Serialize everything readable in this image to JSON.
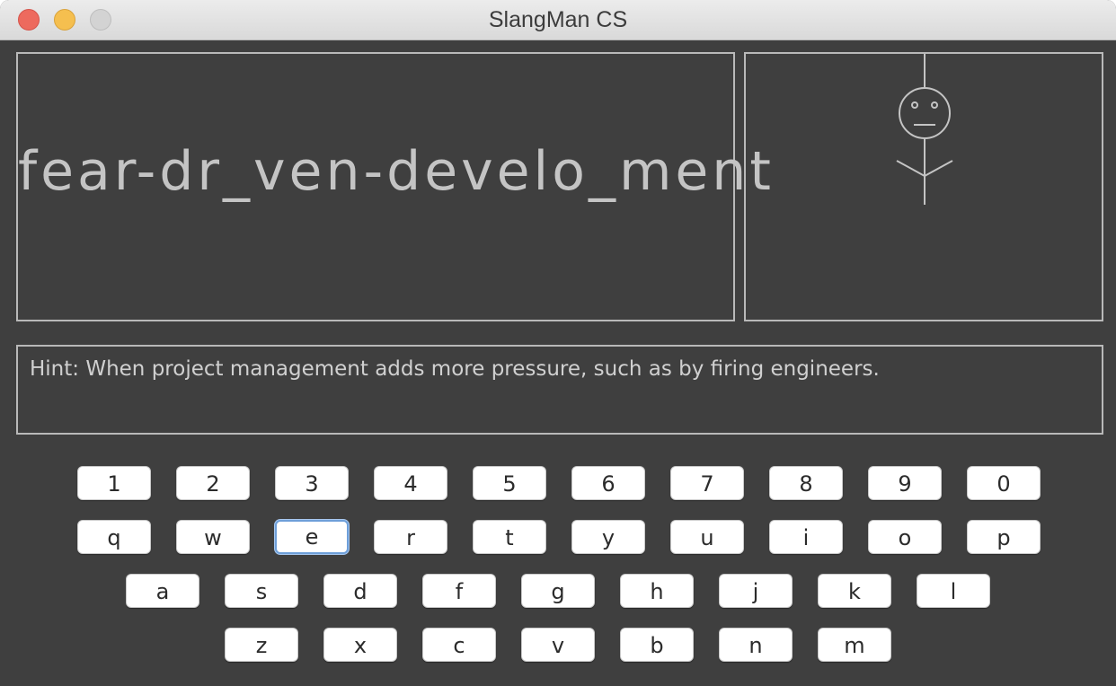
{
  "window": {
    "title": "SlangMan CS"
  },
  "game": {
    "masked_word": "fear-dr_ven-develo_ment",
    "hint": "Hint: When project management adds more pressure, such as by firing engineers.",
    "hangman_parts_shown": [
      "rope",
      "head",
      "face",
      "body",
      "arms"
    ]
  },
  "keyboard": {
    "focused_key": "e",
    "rows": [
      [
        "1",
        "2",
        "3",
        "4",
        "5",
        "6",
        "7",
        "8",
        "9",
        "0"
      ],
      [
        "q",
        "w",
        "e",
        "r",
        "t",
        "y",
        "u",
        "i",
        "o",
        "p"
      ],
      [
        "a",
        "s",
        "d",
        "f",
        "g",
        "h",
        "j",
        "k",
        "l"
      ],
      [
        "z",
        "x",
        "c",
        "v",
        "b",
        "n",
        "m"
      ]
    ]
  },
  "colors": {
    "background": "#3f3f3f",
    "panel_border": "#b9b9b9",
    "text": "#c4c4c4",
    "key_bg": "#ffffff",
    "focus_ring": "#6e9fd9"
  }
}
